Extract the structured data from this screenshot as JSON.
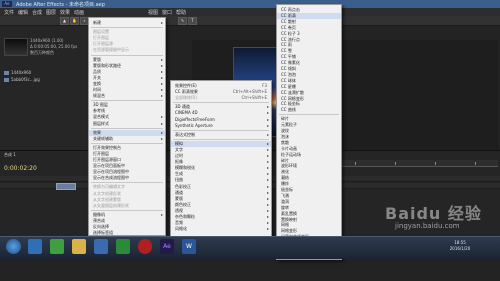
{
  "window": {
    "title": "Adobe After Effects - 未命名项目.aep"
  },
  "menubar": [
    "文件",
    "编辑",
    "合成",
    "图层",
    "效果",
    "动画",
    "视图",
    "窗口",
    "帮助"
  ],
  "project": {
    "info_lines": [
      "1440x960 (1.00)",
      "Δ 0:00:05:00, 25.00 fps",
      "数百万种颜色"
    ],
    "files": [
      "1440x960",
      "5abb0f3c...jpg"
    ]
  },
  "timeline": {
    "timecode": "0:00:02:20",
    "tab": "合成 1"
  },
  "menu1": {
    "items": [
      {
        "label": "新建",
        "arrow": true
      },
      {
        "label": "图层设置",
        "disabled": true
      },
      {
        "label": "打开图层",
        "disabled": true
      },
      {
        "label": "打开图层源",
        "disabled": true
      },
      {
        "label": "在资源管理器中显示",
        "disabled": true
      },
      {
        "label": "蒙版",
        "arrow": true
      },
      {
        "label": "蒙版和形状路径",
        "arrow": true
      },
      {
        "label": "品质",
        "arrow": true
      },
      {
        "label": "开关",
        "arrow": true
      },
      {
        "label": "变换",
        "arrow": true
      },
      {
        "label": "时间",
        "arrow": true
      },
      {
        "label": "帧混合",
        "arrow": true
      },
      {
        "label": "3D 图层"
      },
      {
        "label": "参考线"
      },
      {
        "label": "混合模式",
        "arrow": true
      },
      {
        "label": "图层样式",
        "arrow": true
      },
      {
        "label": "效果",
        "arrow": true,
        "hl": true
      },
      {
        "label": "关键帧辅助",
        "arrow": true
      },
      {
        "label": "打开效果控制台"
      },
      {
        "label": "打开图层"
      },
      {
        "label": "打开图层源窗口"
      },
      {
        "label": "显示在项目面板中"
      },
      {
        "label": "显示在项目流程图中"
      },
      {
        "label": "显示在合成流程图中"
      },
      {
        "label": "转换为可编辑文字",
        "disabled": true
      },
      {
        "label": "从文字创建形状",
        "disabled": true
      },
      {
        "label": "从文字创建蒙版",
        "disabled": true
      },
      {
        "label": "从矢量图层创建形状",
        "disabled": true
      },
      {
        "label": "摄像机",
        "arrow": true
      },
      {
        "label": "预合成"
      },
      {
        "label": "反向选择"
      },
      {
        "label": "选择标签组"
      },
      {
        "label": "重命名"
      }
    ]
  },
  "menu2": {
    "items": [
      {
        "label": "效果控件(E)",
        "shortcut": "F3"
      },
      {
        "label": "CC 雨滴效果",
        "shortcut": "Ctrl+Alt+Shift+E"
      },
      {
        "label": "全部移除(R)",
        "shortcut": "Ctrl+Shift+E",
        "disabled": true
      },
      {
        "label": "3D 通道",
        "arrow": true
      },
      {
        "label": "CINEMA 4D",
        "arrow": true
      },
      {
        "label": "DigieffectsFreeForm",
        "arrow": true
      },
      {
        "label": "Synthetic Aperture",
        "arrow": true
      },
      {
        "label": "表达式控制",
        "arrow": true
      },
      {
        "label": "模拟",
        "arrow": true,
        "hl": true
      },
      {
        "label": "文字",
        "arrow": true
      },
      {
        "label": "过时",
        "arrow": true
      },
      {
        "label": "抠像",
        "arrow": true
      },
      {
        "label": "模糊和锐化",
        "arrow": true
      },
      {
        "label": "生成",
        "arrow": true
      },
      {
        "label": "扭曲",
        "arrow": true
      },
      {
        "label": "色彩校正",
        "arrow": true
      },
      {
        "label": "通道",
        "arrow": true
      },
      {
        "label": "蒙版",
        "arrow": true
      },
      {
        "label": "颜色校正",
        "arrow": true
      },
      {
        "label": "透视",
        "arrow": true
      },
      {
        "label": "杂色和颗粒",
        "arrow": true
      },
      {
        "label": "音频",
        "arrow": true
      },
      {
        "label": "风格化",
        "arrow": true
      }
    ]
  },
  "menu3": {
    "items": [
      {
        "label": "CC 再点击"
      },
      {
        "label": "CC 雨滴",
        "hl": true
      },
      {
        "label": "CC 散射"
      },
      {
        "label": "CC 卷页"
      },
      {
        "label": "CC 粒子 3"
      },
      {
        "label": "CC 流行点"
      },
      {
        "label": "CC 雨"
      },
      {
        "label": "CC 雪"
      },
      {
        "label": "CC 平铺"
      },
      {
        "label": "CC 像素化"
      },
      {
        "label": "CC 倾斜"
      },
      {
        "label": "CC 泡泡"
      },
      {
        "label": "CC 球体"
      },
      {
        "label": "CC 星爆"
      },
      {
        "label": "CC 涟漪扩散"
      },
      {
        "label": "CC 网格变形"
      },
      {
        "label": "CC 极坐标"
      },
      {
        "label": "CC 曲线"
      },
      {
        "label": "碎片"
      },
      {
        "label": "元素粒子"
      },
      {
        "label": "波纹"
      },
      {
        "label": "泡沫"
      },
      {
        "label": "焦散"
      },
      {
        "label": "卡片动画"
      },
      {
        "label": "粒子运动场"
      },
      {
        "label": "碎片"
      },
      {
        "label": "波形环境"
      },
      {
        "label": "液化"
      },
      {
        "label": "凝结"
      },
      {
        "label": "爆炸"
      },
      {
        "label": "极坐标"
      },
      {
        "label": "飞溅"
      },
      {
        "label": "漩涡"
      },
      {
        "label": "旋转"
      },
      {
        "label": "紊乱置换"
      },
      {
        "label": "置换映射"
      },
      {
        "label": "网格"
      },
      {
        "label": "网格变形"
      },
      {
        "label": "贝塞尔曲线变形"
      },
      {
        "label": "湍流置换"
      },
      {
        "label": "边角固定"
      },
      {
        "label": "波形变形"
      }
    ]
  },
  "taskbar": {
    "icons": [
      "start-orb",
      "ie-icon",
      "media-player-icon",
      "explorer-icon",
      "video-icon",
      "player-icon",
      "record-icon",
      "after-effects-icon",
      "word-icon"
    ],
    "time": "18:55",
    "date": "2016/1/20"
  },
  "watermark": {
    "brand": "Baidu 经验",
    "url": "jingyan.baidu.com"
  }
}
